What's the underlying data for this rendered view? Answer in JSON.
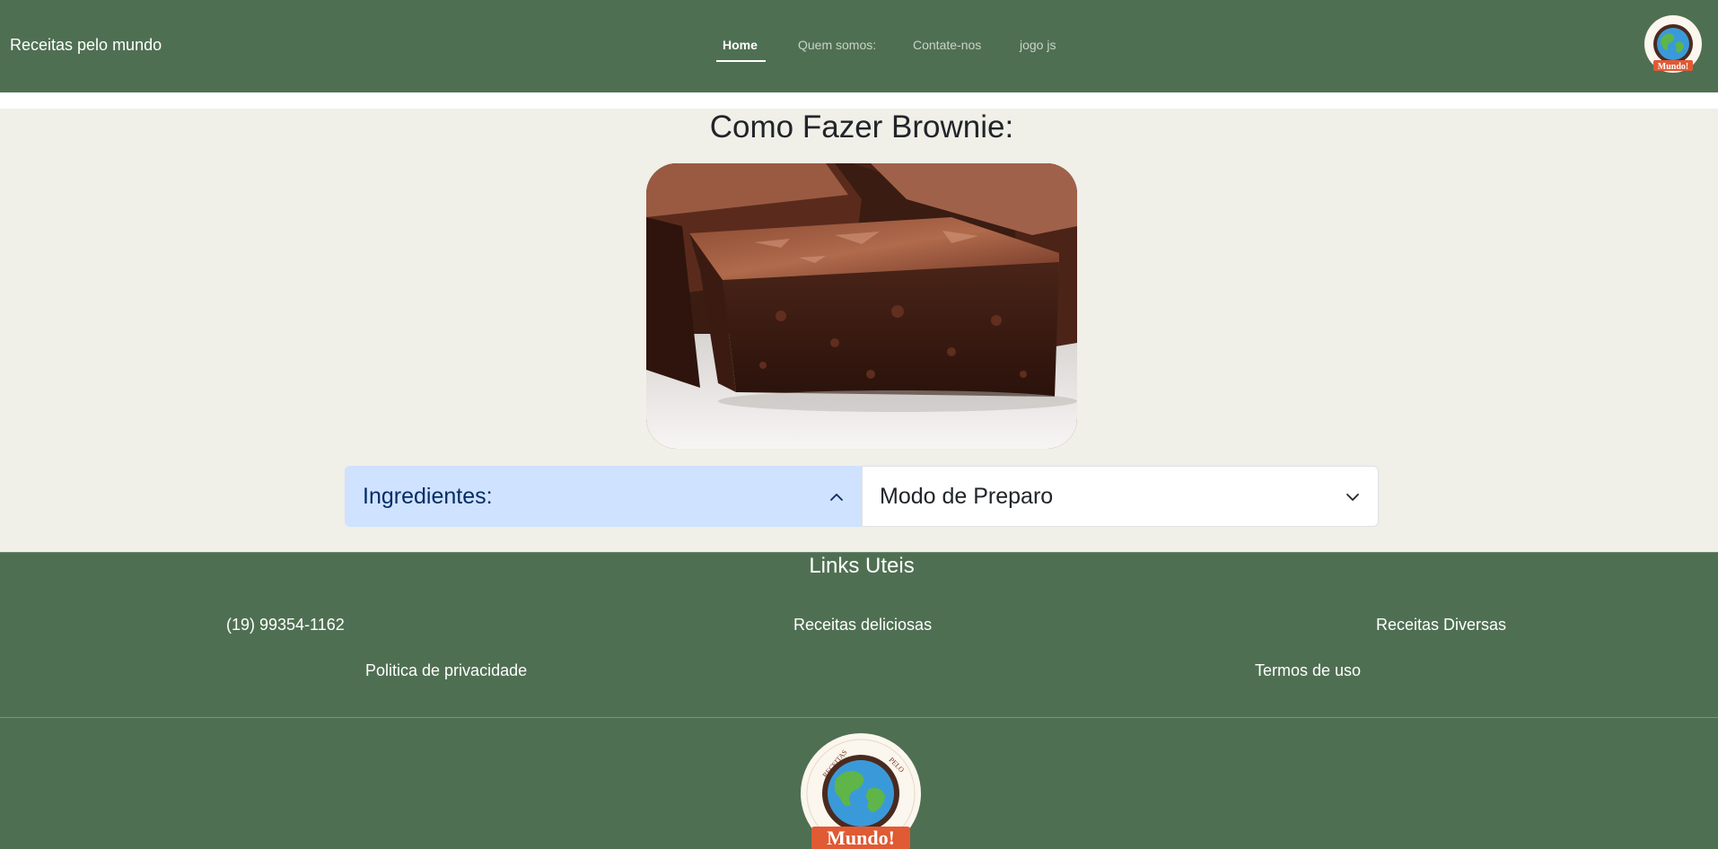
{
  "navbar": {
    "brand": "Receitas pelo mundo",
    "links": [
      {
        "label": "Home",
        "active": true
      },
      {
        "label": "Quem somos:",
        "active": false
      },
      {
        "label": "Contate-nos",
        "active": false
      },
      {
        "label": "jogo js",
        "active": false
      }
    ],
    "bg_color": "#4f6f52"
  },
  "main": {
    "title": "Como Fazer Brownie:",
    "accordion": [
      {
        "label": "Ingredientes:",
        "expanded": true,
        "icon": "chevron-up-icon"
      },
      {
        "label": "Modo de Preparo",
        "expanded": false,
        "icon": "chevron-down-icon"
      }
    ]
  },
  "footer": {
    "title": "Links Uteis",
    "links": [
      {
        "label": "(19) 99354-1162"
      },
      {
        "label": "Receitas deliciosas"
      },
      {
        "label": "Receitas Diversas"
      },
      {
        "label": "Politica de privacidade"
      },
      {
        "label": "Termos de uso"
      }
    ]
  },
  "logo": {
    "text_top_left": "RECEITAS",
    "text_top_right": "PELO",
    "banner": "Mundo!"
  },
  "colors": {
    "header_footer": "#4f6f52",
    "page_bg": "#f0efe8",
    "accordion_active": "#cfe2ff",
    "logo_banner": "#e05a33"
  }
}
